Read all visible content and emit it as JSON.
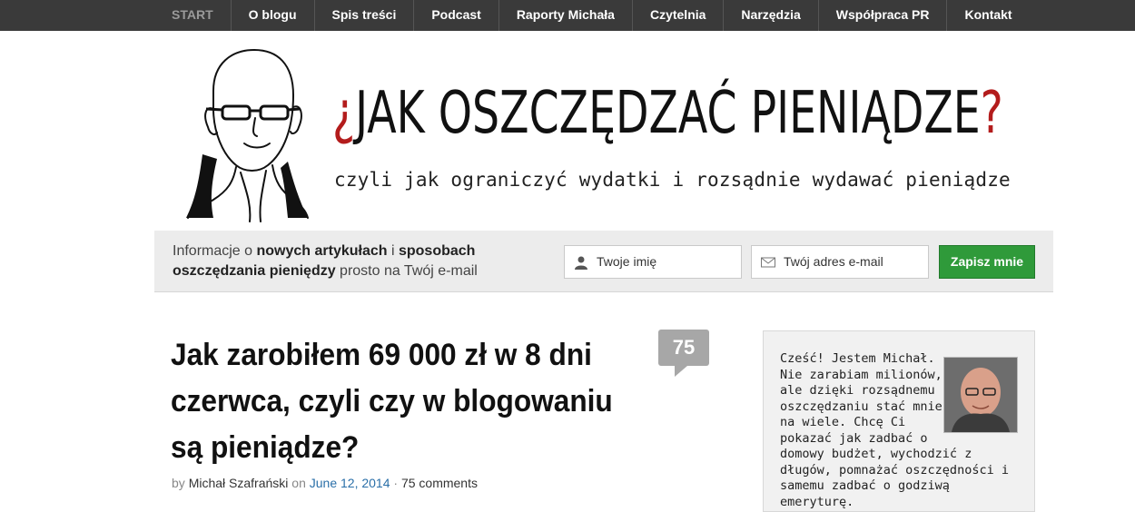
{
  "nav": {
    "items": [
      "START",
      "O blogu",
      "Spis treści",
      "Podcast",
      "Raporty Michała",
      "Czytelnia",
      "Narzędzia",
      "Współpraca PR",
      "Kontakt"
    ]
  },
  "header": {
    "title_main": "JAK OSZCZĘDZAĆ PIENIĄDZE",
    "title_open_mark": "¿",
    "title_close_mark": "?",
    "tagline": "czyli jak ograniczyć wydatki i rozsądnie wydawać pieniądze",
    "portrait_icon": "author-sketch-icon"
  },
  "subscribe": {
    "info_1": "Informacje o ",
    "info_2": "nowych artykułach",
    "info_3": " i ",
    "info_4": "sposobach oszczędzania pieniędzy",
    "info_5": " prosto na Twój e-mail",
    "name_placeholder": "Twoje imię",
    "email_placeholder": "Twój adres e-mail",
    "button_label": "Zapisz mnie",
    "button_color": "#2f9a3a"
  },
  "article": {
    "title": "Jak zarobiłem 69 000 zł w 8 dni czerwca, czyli czy w blogowaniu są pieniądze?",
    "comments_count": "75",
    "by": "by",
    "author": "Michał Szafrański",
    "on": "on",
    "date": "June 12, 2014",
    "sep": "·",
    "comments_label": "75 comments"
  },
  "sidebar": {
    "about_text": "Cześć! Jestem Michał. Nie zarabiam milionów, ale dzięki rozsądnemu oszczędzaniu stać mnie na wiele. Chcę Ci pokazać jak zadbać o domowy budżet, wychodzić z długów, pomnażać oszczędności i samemu zadbać o godziwą emeryturę."
  },
  "colors": {
    "accent_red": "#b31c1c",
    "nav_bg": "#3a3a3a"
  }
}
